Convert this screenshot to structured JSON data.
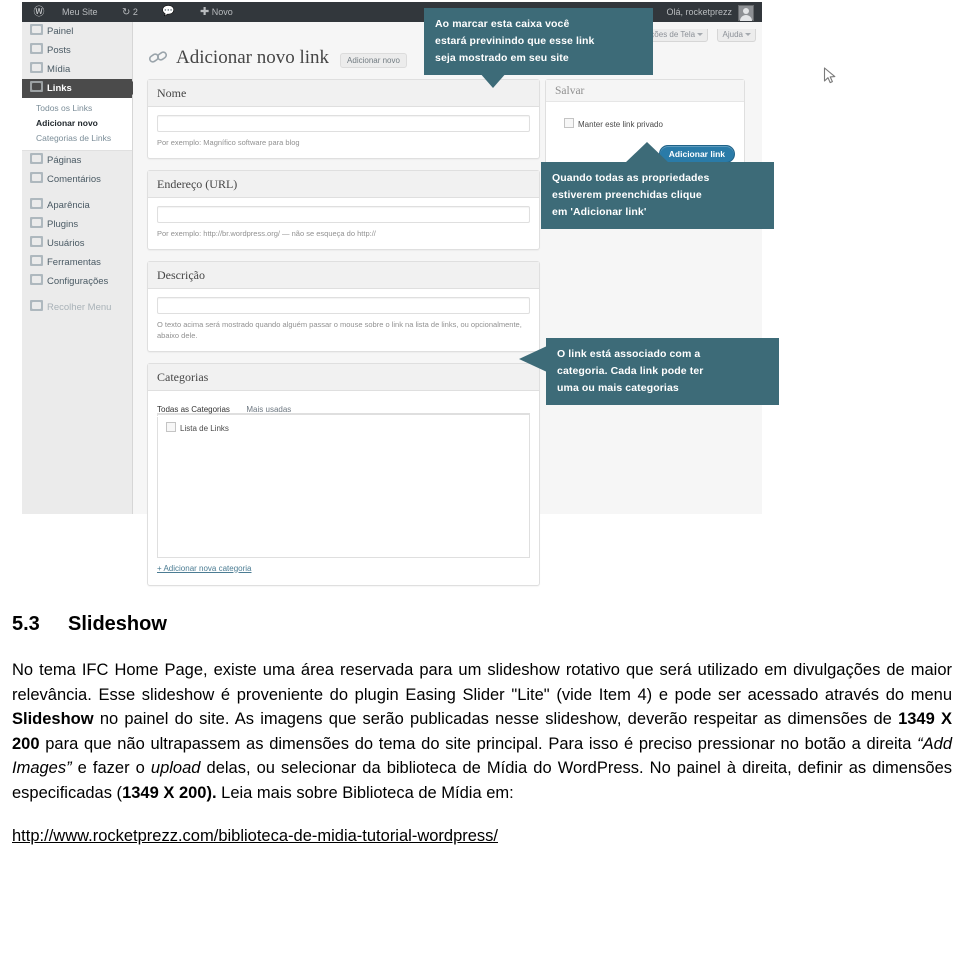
{
  "screenshot": {
    "adminbar": {
      "wp_logo": "Ⓦ",
      "site_name": "Meu Site",
      "updates_count": "2",
      "comments_icon": "comment-icon",
      "new_label": "Novo",
      "howdy": "Olá, rocketprezz"
    },
    "sidebar": {
      "items": [
        {
          "label": "Painel",
          "icon": "dashboard-icon",
          "current": false
        },
        {
          "label": "Posts",
          "icon": "pin-icon",
          "current": false
        },
        {
          "label": "Mídia",
          "icon": "media-icon",
          "current": false
        },
        {
          "label": "Links",
          "icon": "link-icon",
          "current": true
        }
      ],
      "submenu": [
        {
          "label": "Todos os Links",
          "active": false
        },
        {
          "label": "Adicionar novo",
          "active": true
        },
        {
          "label": "Categorias de Links",
          "active": false
        }
      ],
      "items2": [
        {
          "label": "Páginas",
          "icon": "page-icon"
        },
        {
          "label": "Comentários",
          "icon": "comments-icon"
        }
      ],
      "items3": [
        {
          "label": "Aparência",
          "icon": "appearance-icon"
        },
        {
          "label": "Plugins",
          "icon": "plugin-icon"
        },
        {
          "label": "Usuários",
          "icon": "users-icon"
        },
        {
          "label": "Ferramentas",
          "icon": "tools-icon"
        },
        {
          "label": "Configurações",
          "icon": "settings-icon"
        }
      ],
      "collapse": "Recolher Menu"
    },
    "screen_options": {
      "screen": "Opções de Tela",
      "help": "Ajuda"
    },
    "page": {
      "icon": "link-chain-icon",
      "title": "Adicionar novo link",
      "add_new_button": "Adicionar novo"
    },
    "fields": [
      {
        "label": "Nome",
        "value": "",
        "hint": "Por exemplo: Magnífico software para blog"
      },
      {
        "label": "Endereço (URL)",
        "value": "",
        "hint": "Por exemplo:  http://br.wordpress.org/  — não se esqueça do  http://"
      },
      {
        "label": "Descrição",
        "value": "",
        "hint": "O texto acima será mostrado quando alguém passar o mouse sobre o link na lista de links, ou opcionalmente, abaixo dele."
      }
    ],
    "categories": {
      "title": "Categorias",
      "tabs": [
        {
          "label": "Todas as Categorias",
          "active": true
        },
        {
          "label": "Mais usadas",
          "active": false
        }
      ],
      "items": [
        {
          "label": "Lista de Links",
          "checked": false
        }
      ],
      "add_new": "+ Adicionar nova categoria"
    },
    "publish": {
      "title": "Salvar",
      "private_checkbox_label": "Manter este link privado",
      "submit_label": "Adicionar link",
      "accent": "#2a7ba8"
    },
    "callouts": [
      {
        "id": "callout1",
        "lines": [
          "Ao marcar esta caixa você",
          "estará previnindo que esse link",
          "seja mostrado em seu site"
        ]
      },
      {
        "id": "callout2",
        "lines": [
          "Quando todas as propriedades",
          "estiverem preenchidas clique",
          "em 'Adicionar  link'"
        ]
      },
      {
        "id": "callout3",
        "lines": [
          "O link está associado  com a",
          "categoria. Cada link pode ter",
          "uma ou mais categorias"
        ]
      }
    ],
    "callout_color": "#3d6b78"
  },
  "document": {
    "heading_number": "5.3",
    "heading_text": "Slideshow",
    "paragraph": {
      "p1": "No tema IFC Home Page, existe uma área reservada para um slideshow rotativo que será utilizado em divulgações de maior relevância. Esse slideshow é proveniente do plugin Easing Slider \"Lite\" (vide Item 4) e pode ser acessado através do menu ",
      "b1": "Slideshow",
      "p2": " no painel do site. As imagens que serão publicadas nesse slideshow, deverão respeitar as dimensões de ",
      "b2": "1349 X 200",
      "p3": " para que não ultrapassem as dimensões do tema do site principal. Para isso é preciso pressionar no botão a direita ",
      "i1": "“Add Images”",
      "p4": " e fazer o ",
      "i2": "upload",
      "p5": " delas, ou selecionar da biblioteca de Mídia do WordPress. No painel à direita, definir as dimensões especificadas (",
      "b3": "1349 X 200).",
      "p6": " Leia mais sobre Biblioteca de Mídia em:"
    },
    "link": "http://www.rocketprezz.com/biblioteca-de-midia-tutorial-wordpress/"
  }
}
